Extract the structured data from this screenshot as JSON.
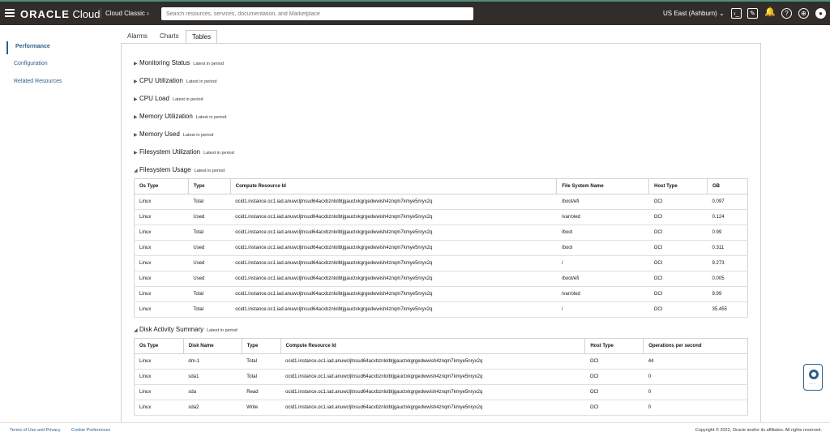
{
  "header": {
    "brand": "ORACLE",
    "brand_suffix": " Cloud",
    "console_mode": "Cloud Classic",
    "search_placeholder": "Search resources, services, documentation, and Marketplace",
    "region": "US East (Ashburn)"
  },
  "sidebar": {
    "items": [
      {
        "label": "Performance"
      },
      {
        "label": "Configuration"
      },
      {
        "label": "Related Resources"
      }
    ]
  },
  "tabs": [
    {
      "label": "Alarms"
    },
    {
      "label": "Charts"
    },
    {
      "label": "Tables"
    }
  ],
  "sections": [
    {
      "title": "Monitoring Status",
      "sub": "Latest in period"
    },
    {
      "title": "CPU Utilization",
      "sub": "Latest in period"
    },
    {
      "title": "CPU Load",
      "sub": "Latest in period"
    },
    {
      "title": "Memory Utilization",
      "sub": "Latest in period"
    },
    {
      "title": "Memory Used",
      "sub": "Latest in period"
    },
    {
      "title": "Filesystem Utilization",
      "sub": "Latest in period"
    },
    {
      "title": "Filesystem Usage",
      "sub": "Latest in period"
    },
    {
      "title": "Disk Activity Summary",
      "sub": "Latest in period"
    }
  ],
  "fs_table": {
    "headers": [
      "Os Type",
      "Type",
      "Compute Resource Id",
      "File System Name",
      "Host Type",
      "GB"
    ],
    "rows": [
      [
        "Linux",
        "Total",
        "ocid1.instance.oc1.iad.anuwcljtnsud64acxbznlolbtjgauctxkgrgedwwish4znqm7kmye5nryx2q",
        "/boot/efi",
        "OCI",
        "0.097"
      ],
      [
        "Linux",
        "Used",
        "ocid1.instance.oc1.iad.anuwcljtnsud64acxbznlolbtjgauctxkgrgedwwish4znqm7kmye5nryx2q",
        "/var/oled",
        "OCI",
        "0.124"
      ],
      [
        "Linux",
        "Total",
        "ocid1.instance.oc1.iad.anuwcljtnsud64acxbznlolbtjgauctxkgrgedwwish4znqm7kmye5nryx2q",
        "/boot",
        "OCI",
        "0.99"
      ],
      [
        "Linux",
        "Used",
        "ocid1.instance.oc1.iad.anuwcljtnsud64acxbznlolbtjgauctxkgrgedwwish4znqm7kmye5nryx2q",
        "/boot",
        "OCI",
        "0.311"
      ],
      [
        "Linux",
        "Used",
        "ocid1.instance.oc1.iad.anuwcljtnsud64acxbznlolbtjgauctxkgrgedwwish4znqm7kmye5nryx2q",
        "/",
        "OCI",
        "9.273"
      ],
      [
        "Linux",
        "Used",
        "ocid1.instance.oc1.iad.anuwcljtnsud64acxbznlolbtjgauctxkgrgedwwish4znqm7kmye5nryx2q",
        "/boot/efi",
        "OCI",
        "0.005"
      ],
      [
        "Linux",
        "Total",
        "ocid1.instance.oc1.iad.anuwcljtnsud64acxbznlolbtjgauctxkgrgedwwish4znqm7kmye5nryx2q",
        "/var/oled",
        "OCI",
        "9.99"
      ],
      [
        "Linux",
        "Total",
        "ocid1.instance.oc1.iad.anuwcljtnsud64acxbznlolbtjgauctxkgrgedwwish4znqm7kmye5nryx2q",
        "/",
        "OCI",
        "35.455"
      ]
    ]
  },
  "disk_table": {
    "headers": [
      "Os Type",
      "Disk Name",
      "Type",
      "Compute Resource Id",
      "Host Type",
      "Operations per second"
    ],
    "rows": [
      [
        "Linux",
        "dm-1",
        "Total",
        "ocid1.instance.oc1.iad.anuwcljtnsud64acxbznlolbtjgauctxkgrgedwwish4znqm7kmye5nryx2q",
        "OCI",
        "44"
      ],
      [
        "Linux",
        "sda1",
        "Total",
        "ocid1.instance.oc1.iad.anuwcljtnsud64acxbznlolbtjgauctxkgrgedwwish4znqm7kmye5nryx2q",
        "OCI",
        "0"
      ],
      [
        "Linux",
        "sda",
        "Read",
        "ocid1.instance.oc1.iad.anuwcljtnsud64acxbznlolbtjgauctxkgrgedwwish4znqm7kmye5nryx2q",
        "OCI",
        "0"
      ],
      [
        "Linux",
        "sda2",
        "Write",
        "ocid1.instance.oc1.iad.anuwcljtnsud64acxbznlolbtjgauctxkgrgedwwish4znqm7kmye5nryx2q",
        "OCI",
        "0"
      ]
    ]
  },
  "footer": {
    "terms": "Terms of Use and Privacy",
    "cookies": "Cookie Preferences",
    "copyright": "Copyright © 2022, Oracle and/or its affiliates. All rights reserved."
  },
  "colors": {
    "header_bg": "#312d2a",
    "link": "#2c5f8a"
  },
  "icons": [
    "menu-icon",
    "cloud-shell-icon",
    "edit-icon",
    "notification-icon",
    "help-icon",
    "language-icon",
    "profile-icon",
    "chevron-down-icon",
    "support-icon"
  ]
}
